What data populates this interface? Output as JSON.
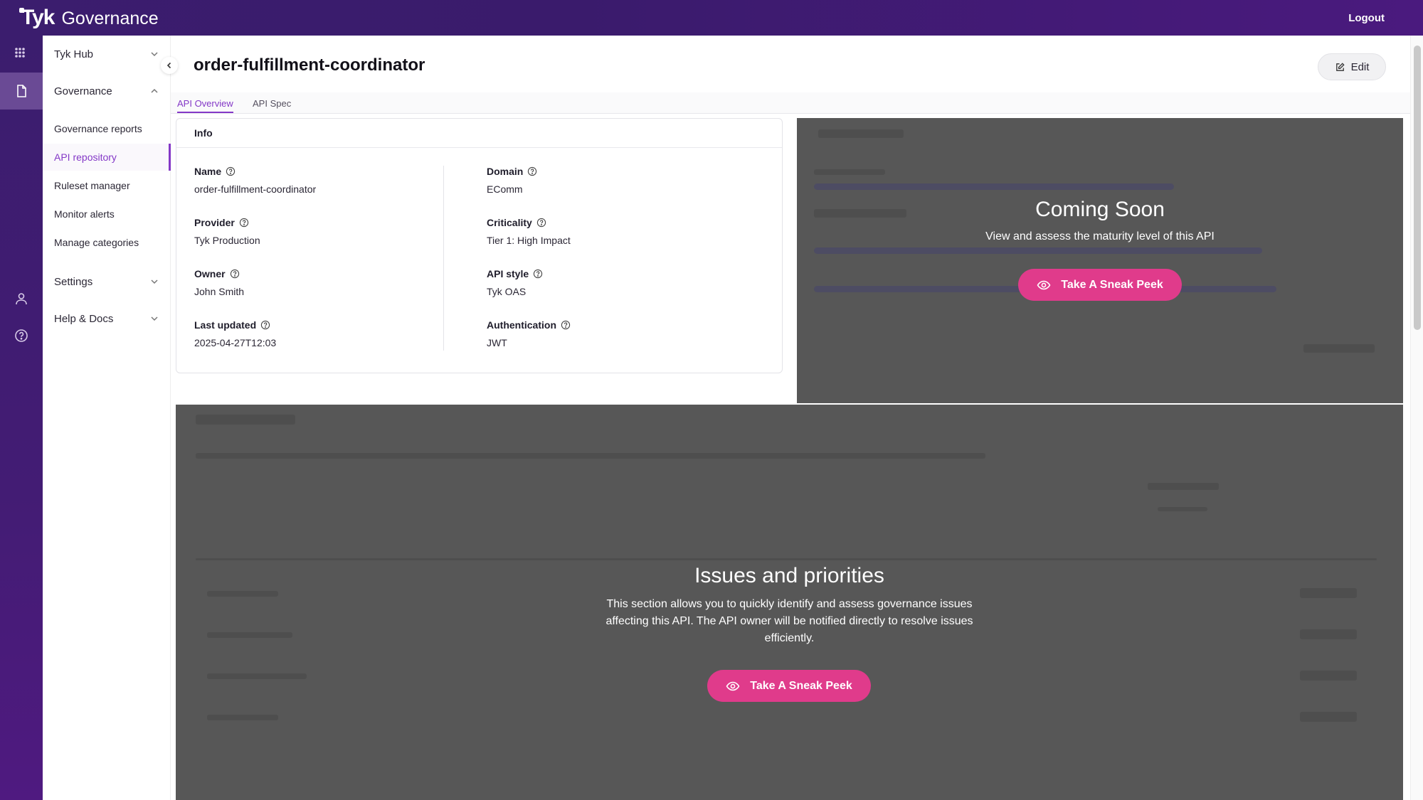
{
  "header": {
    "logo_text": "Tyk",
    "product": "Governance",
    "logout_label": "Logout"
  },
  "sidebar": {
    "sections": {
      "hub": "Tyk Hub",
      "governance": "Governance",
      "settings": "Settings",
      "help": "Help & Docs"
    },
    "items": [
      {
        "label": "Governance reports"
      },
      {
        "label": "API repository"
      },
      {
        "label": "Ruleset manager"
      },
      {
        "label": "Monitor alerts"
      },
      {
        "label": "Manage categories"
      }
    ]
  },
  "main": {
    "title": "order-fulfillment-coordinator",
    "edit_label": "Edit",
    "tabs": [
      {
        "label": "API Overview"
      },
      {
        "label": "API Spec"
      }
    ],
    "info": {
      "header": "Info",
      "fields": {
        "name": {
          "label": "Name",
          "value": "order-fulfillment-coordinator"
        },
        "provider": {
          "label": "Provider",
          "value": "Tyk Production"
        },
        "owner": {
          "label": "Owner",
          "value": "John Smith"
        },
        "last_updated": {
          "label": "Last updated",
          "value": "2025-04-27T12:03"
        },
        "domain": {
          "label": "Domain",
          "value": "EComm"
        },
        "criticality": {
          "label": "Criticality",
          "value": "Tier 1: High Impact"
        },
        "api_style": {
          "label": "API style",
          "value": "Tyk OAS"
        },
        "authentication": {
          "label": "Authentication",
          "value": "JWT"
        }
      }
    },
    "maturity_panel": {
      "title": "Coming Soon",
      "description": "View and assess the maturity level of this API",
      "button_label": "Take A Sneak Peek"
    },
    "issues_panel": {
      "title": "Issues and priorities",
      "description_lines": [
        "This section allows you to quickly identify and assess governance issues",
        "affecting this API. The API owner will be notified directly to resolve issues",
        "efficiently."
      ],
      "button_label": "Take A Sneak Peek"
    }
  },
  "colors": {
    "brand_purple": "#3b1d6e",
    "accent": "#8438c7",
    "cta_pink": "#e03b8b",
    "overlay_gray": "#575757"
  }
}
